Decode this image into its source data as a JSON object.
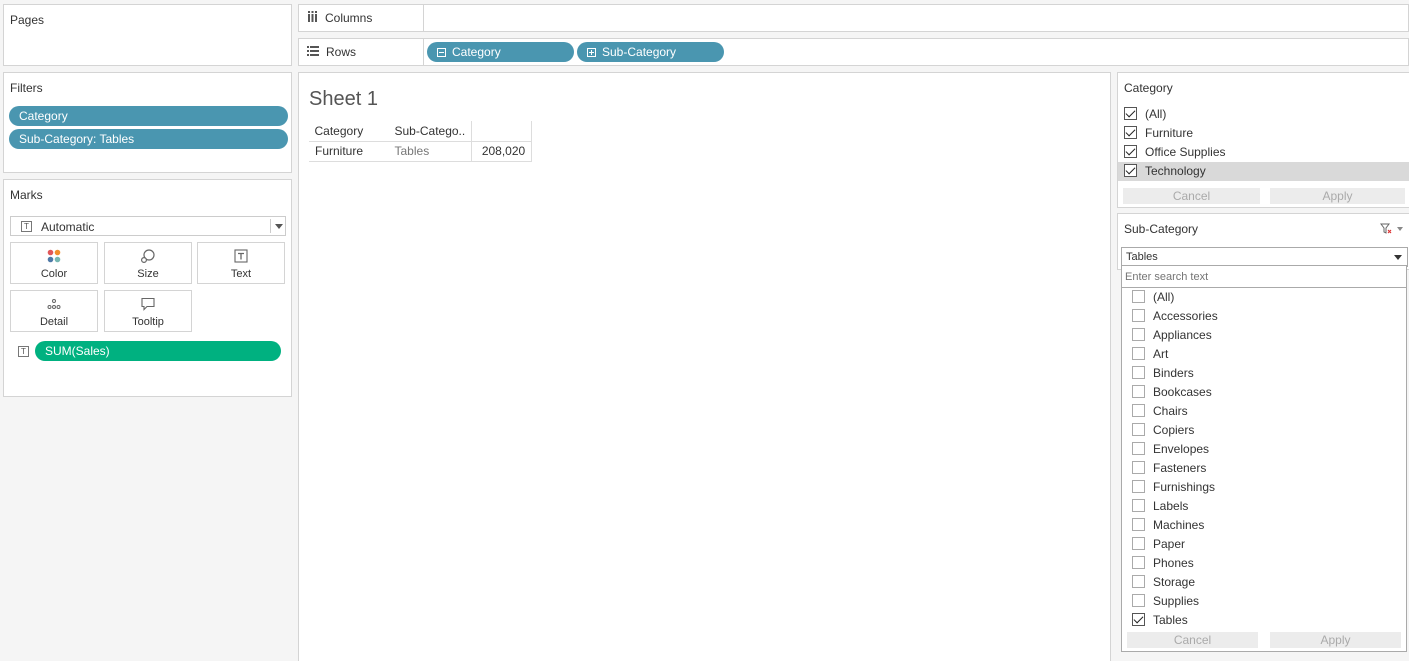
{
  "pages": {
    "title": "Pages"
  },
  "filters": {
    "title": "Filters",
    "pills": [
      "Category",
      "Sub-Category: Tables"
    ]
  },
  "marks": {
    "title": "Marks",
    "mark_type": "Automatic",
    "buttons": {
      "color": "Color",
      "size": "Size",
      "text": "Text",
      "detail": "Detail",
      "tooltip": "Tooltip"
    },
    "field_pill": "SUM(Sales)"
  },
  "shelves": {
    "columns_label": "Columns",
    "rows_label": "Rows",
    "rows_pills": [
      "Category",
      "Sub-Category"
    ]
  },
  "sheet": {
    "title": "Sheet 1",
    "headers": [
      "Category",
      "Sub-Catego..",
      ""
    ],
    "row": {
      "category": "Furniture",
      "subcategory": "Tables",
      "value": "208,020"
    }
  },
  "category_filter": {
    "title": "Category",
    "items": [
      {
        "label": "(All)",
        "checked": true
      },
      {
        "label": "Furniture",
        "checked": true
      },
      {
        "label": "Office Supplies",
        "checked": true
      },
      {
        "label": "Technology",
        "checked": true
      }
    ],
    "cancel": "Cancel",
    "apply": "Apply"
  },
  "subcategory_filter": {
    "title": "Sub-Category",
    "selected": "Tables",
    "search_placeholder": "Enter search text",
    "items": [
      {
        "label": "(All)",
        "checked": false
      },
      {
        "label": "Accessories",
        "checked": false
      },
      {
        "label": "Appliances",
        "checked": false
      },
      {
        "label": "Art",
        "checked": false
      },
      {
        "label": "Binders",
        "checked": false
      },
      {
        "label": "Bookcases",
        "checked": false
      },
      {
        "label": "Chairs",
        "checked": false
      },
      {
        "label": "Copiers",
        "checked": false
      },
      {
        "label": "Envelopes",
        "checked": false
      },
      {
        "label": "Fasteners",
        "checked": false
      },
      {
        "label": "Furnishings",
        "checked": false
      },
      {
        "label": "Labels",
        "checked": false
      },
      {
        "label": "Machines",
        "checked": false
      },
      {
        "label": "Paper",
        "checked": false
      },
      {
        "label": "Phones",
        "checked": false
      },
      {
        "label": "Storage",
        "checked": false
      },
      {
        "label": "Supplies",
        "checked": false
      },
      {
        "label": "Tables",
        "checked": true
      }
    ],
    "cancel": "Cancel",
    "apply": "Apply"
  },
  "colors": {
    "dimension_pill": "#4a96b0",
    "measure_pill": "#00b180"
  }
}
